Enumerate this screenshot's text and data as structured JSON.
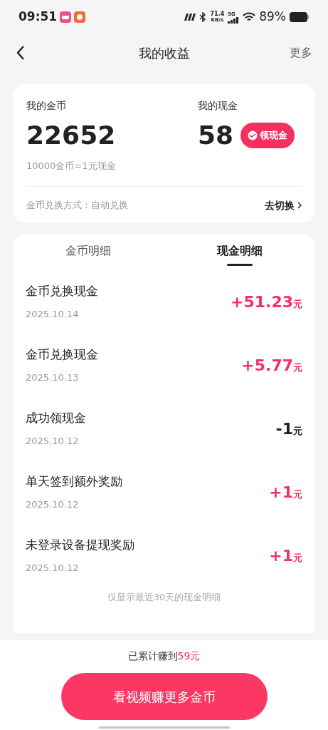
{
  "status_bar": {
    "time": "09:51",
    "net_speed": "71.4",
    "net_unit": "KB/s",
    "network": "5G",
    "battery": "89%"
  },
  "nav": {
    "title": "我的收益",
    "more": "更多"
  },
  "summary": {
    "coins_label": "我的金币",
    "coins": "22652",
    "cash_label": "我的现金",
    "cash": "58",
    "withdraw_button": "领现金",
    "rate": "10000金币=1元现金",
    "exchange_mode": "金币兑换方式：自动兑换",
    "switch_link": "去切换"
  },
  "tabs": [
    {
      "label": "金币明细",
      "selected": false
    },
    {
      "label": "现金明细",
      "selected": true
    }
  ],
  "transactions": [
    {
      "title": "金币兑换现金",
      "date": "2025.10.14",
      "amount": "+51.23",
      "unit": "元",
      "kind": "income"
    },
    {
      "title": "金币兑换现金",
      "date": "2025.10.13",
      "amount": "+5.77",
      "unit": "元",
      "kind": "income"
    },
    {
      "title": "成功领现金",
      "date": "2025.10.12",
      "amount": "-1",
      "unit": "元",
      "kind": "expense"
    },
    {
      "title": "单天签到额外奖励",
      "date": "2025.10.12",
      "amount": "+1",
      "unit": "元",
      "kind": "income"
    },
    {
      "title": "未登录设备提现奖励",
      "date": "2025.10.12",
      "amount": "+1",
      "unit": "元",
      "kind": "income"
    }
  ],
  "list_note": "仅显示最近30天的现金明细",
  "footer": {
    "total_prefix": "已累计赚到",
    "total_amount": "59元",
    "button": "看视频赚更多金币"
  }
}
